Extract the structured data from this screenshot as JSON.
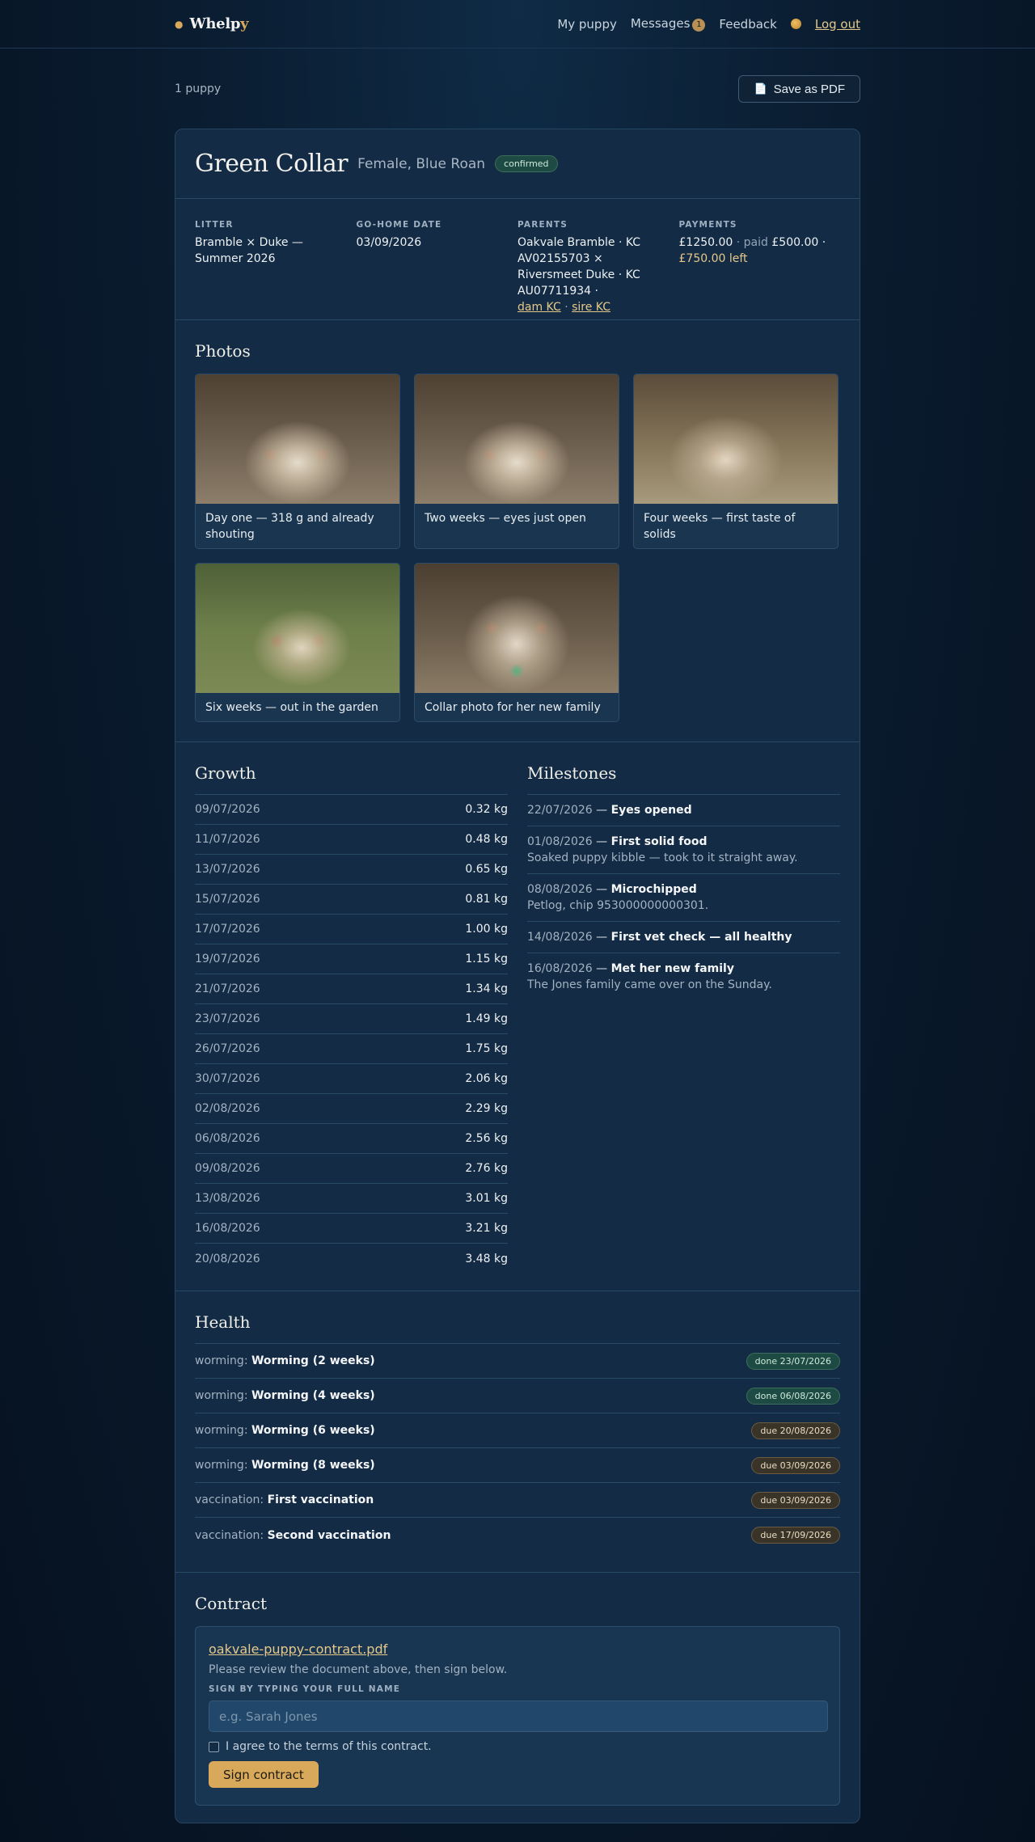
{
  "nav": {
    "brand": "Whelp",
    "brand_suffix": "y",
    "my_puppy": "My puppy",
    "messages": "Messages",
    "messages_count": "1",
    "feedback": "Feedback",
    "logout": "Log out"
  },
  "subbar": {
    "count": "1 puppy",
    "pdf_label": "Save as PDF"
  },
  "puppy": {
    "name": "Green Collar",
    "details": "Female, Blue Roan",
    "status": "confirmed"
  },
  "info": {
    "litter_label": "LITTER",
    "litter": "Bramble × Duke — Summer 2026",
    "gohome_label": "GO-HOME DATE",
    "gohome": "03/09/2026",
    "parents_label": "PARENTS",
    "parents": "Oakvale Bramble · KC AV02155703 × Riversmeet Duke · KC AU07711934 ·",
    "dam_kc": "dam KC",
    "sep": "·",
    "sire_kc": "sire KC",
    "payments_label": "PAYMENTS",
    "total": "£1250.00",
    "paid_label": "· paid",
    "paid": "£500.00 ·",
    "left": "£750.00 left"
  },
  "photos": {
    "title": "Photos",
    "items": [
      {
        "caption": "Day one — 318 g and already shouting"
      },
      {
        "caption": "Two weeks — eyes just open"
      },
      {
        "caption": "Four weeks — first taste of solids"
      },
      {
        "caption": "Six weeks — out in the garden"
      },
      {
        "caption": "Collar photo for her new family"
      }
    ]
  },
  "growth": {
    "title": "Growth",
    "rows": [
      {
        "date": "09/07/2026",
        "weight": "0.32 kg"
      },
      {
        "date": "11/07/2026",
        "weight": "0.48 kg"
      },
      {
        "date": "13/07/2026",
        "weight": "0.65 kg"
      },
      {
        "date": "15/07/2026",
        "weight": "0.81 kg"
      },
      {
        "date": "17/07/2026",
        "weight": "1.00 kg"
      },
      {
        "date": "19/07/2026",
        "weight": "1.15 kg"
      },
      {
        "date": "21/07/2026",
        "weight": "1.34 kg"
      },
      {
        "date": "23/07/2026",
        "weight": "1.49 kg"
      },
      {
        "date": "26/07/2026",
        "weight": "1.75 kg"
      },
      {
        "date": "30/07/2026",
        "weight": "2.06 kg"
      },
      {
        "date": "02/08/2026",
        "weight": "2.29 kg"
      },
      {
        "date": "06/08/2026",
        "weight": "2.56 kg"
      },
      {
        "date": "09/08/2026",
        "weight": "2.76 kg"
      },
      {
        "date": "13/08/2026",
        "weight": "3.01 kg"
      },
      {
        "date": "16/08/2026",
        "weight": "3.21 kg"
      },
      {
        "date": "20/08/2026",
        "weight": "3.48 kg"
      }
    ]
  },
  "milestones": {
    "title": "Milestones",
    "items": [
      {
        "date": "22/07/2026",
        "title": "Eyes opened",
        "note": ""
      },
      {
        "date": "01/08/2026",
        "title": "First solid food",
        "note": "Soaked puppy kibble — took to it straight away."
      },
      {
        "date": "08/08/2026",
        "title": "Microchipped",
        "note": "Petlog, chip 953000000000301."
      },
      {
        "date": "14/08/2026",
        "title": "First vet check — all healthy",
        "note": ""
      },
      {
        "date": "16/08/2026",
        "title": "Met her new family",
        "note": "The Jones family came over on the Sunday."
      }
    ]
  },
  "health": {
    "title": "Health",
    "rows": [
      {
        "type": "worming:",
        "name": "Worming (2 weeks)",
        "status": "done 23/07/2026",
        "state": "done"
      },
      {
        "type": "worming:",
        "name": "Worming (4 weeks)",
        "status": "done 06/08/2026",
        "state": "done"
      },
      {
        "type": "worming:",
        "name": "Worming (6 weeks)",
        "status": "due 20/08/2026",
        "state": "due"
      },
      {
        "type": "worming:",
        "name": "Worming (8 weeks)",
        "status": "due 03/09/2026",
        "state": "due"
      },
      {
        "type": "vaccination:",
        "name": "First vaccination",
        "status": "due 03/09/2026",
        "state": "due"
      },
      {
        "type": "vaccination:",
        "name": "Second vaccination",
        "status": "due 17/09/2026",
        "state": "due"
      }
    ]
  },
  "contract": {
    "title": "Contract",
    "file": "oakvale-puppy-contract.pdf",
    "hint": "Please review the document above, then sign below.",
    "sign_label": "SIGN BY TYPING YOUR FULL NAME",
    "placeholder": "e.g. Sarah Jones",
    "agree": "I agree to the terms of this contract.",
    "button": "Sign contract"
  }
}
